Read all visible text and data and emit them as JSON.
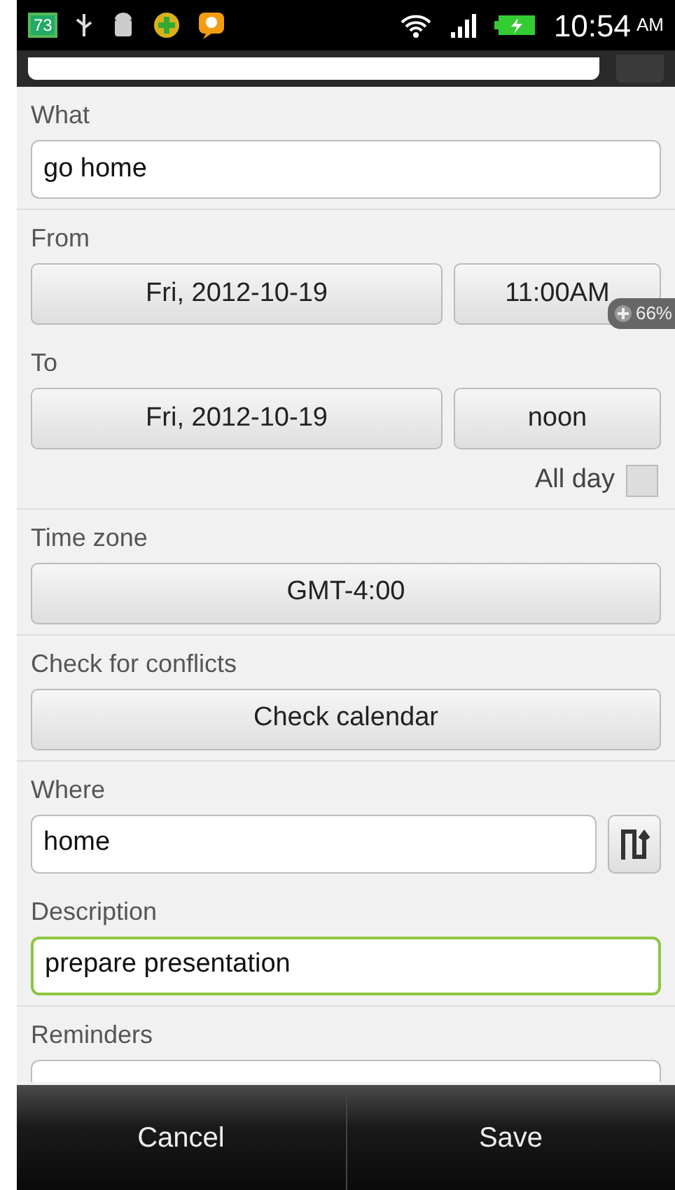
{
  "status_bar": {
    "notification_badge": "73",
    "time": "10:54",
    "meridiem": "AM"
  },
  "sections": [
    {
      "kind": "text",
      "label": "What",
      "value": "go home",
      "focused": false
    },
    {
      "kind": "datetime",
      "label": "From",
      "date": "Fri, 2012-10-19",
      "time": "11:00AM"
    },
    {
      "kind": "datetime",
      "label": "To",
      "date": "Fri, 2012-10-19",
      "time": "noon",
      "all_day": {
        "label": "All day",
        "checked": false
      }
    },
    {
      "kind": "button",
      "label": "Time zone",
      "button": "GMT-4:00"
    },
    {
      "kind": "button",
      "label": "Check for conflicts",
      "button": "Check calendar"
    },
    {
      "kind": "location",
      "label": "Where",
      "value": "home",
      "focused": false
    },
    {
      "kind": "text",
      "label": "Description",
      "value": "prepare presentation",
      "focused": true
    },
    {
      "kind": "dropdown",
      "label": "Reminders"
    }
  ],
  "zoom_badge": "66%",
  "actions": [
    "Cancel",
    "Save"
  ]
}
